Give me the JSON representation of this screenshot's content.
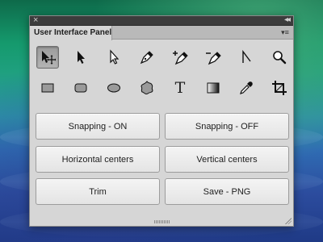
{
  "panel": {
    "title": "User Interface Panel",
    "close_glyph": "×",
    "collapse_glyph": "◂◂",
    "menu_glyph": "▾≡"
  },
  "tools": [
    {
      "name": "move-select-icon",
      "active": true
    },
    {
      "name": "selection-arrow-icon",
      "active": false
    },
    {
      "name": "direct-selection-arrow-icon",
      "active": false
    },
    {
      "name": "pen-tool-icon",
      "active": false
    },
    {
      "name": "add-anchor-point-icon",
      "active": false
    },
    {
      "name": "delete-anchor-point-icon",
      "active": false
    },
    {
      "name": "convert-anchor-point-icon",
      "active": false
    },
    {
      "name": "zoom-icon",
      "active": false
    },
    {
      "name": "rectangle-icon",
      "active": false
    },
    {
      "name": "rounded-rectangle-icon",
      "active": false
    },
    {
      "name": "ellipse-icon",
      "active": false
    },
    {
      "name": "custom-shape-icon",
      "active": false
    },
    {
      "name": "type-tool-icon",
      "active": false,
      "glyph": "T"
    },
    {
      "name": "gradient-icon",
      "active": false
    },
    {
      "name": "eyedropper-icon",
      "active": false
    },
    {
      "name": "crop-icon",
      "active": false
    }
  ],
  "buttons": {
    "snapping_on": "Snapping - ON",
    "snapping_off": "Snapping - OFF",
    "horizontal_centers": "Horizontal centers",
    "vertical_centers": "Vertical centers",
    "trim": "Trim",
    "save_png": "Save - PNG"
  },
  "colors": {
    "panel_bg": "#d6d6d6",
    "titlebar_bg": "#3c3c3c",
    "button_bg": "#eeeeee",
    "active_tool_bg": "#a8a8a8"
  }
}
